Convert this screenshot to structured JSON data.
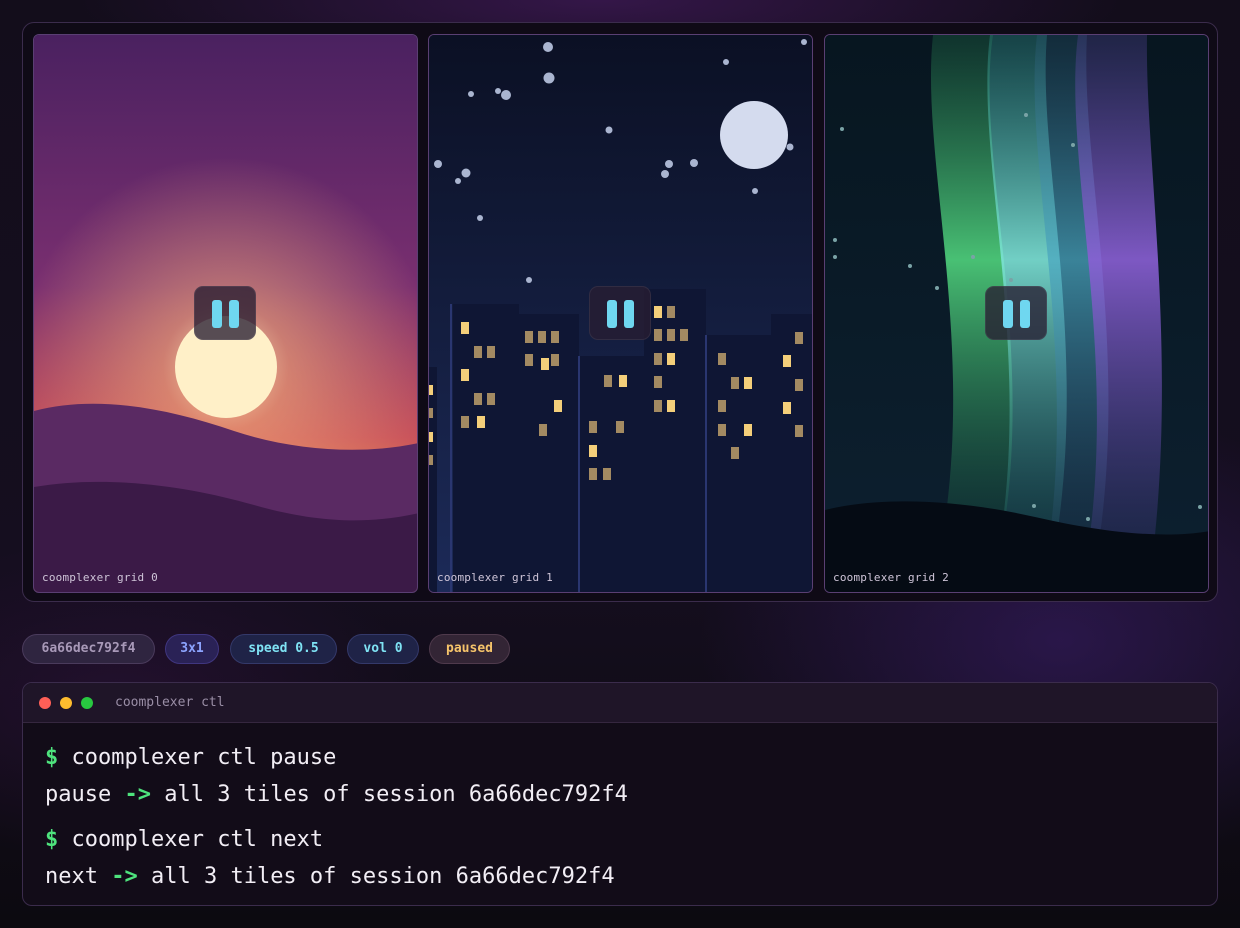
{
  "tiles": [
    {
      "caption": "coomplexer grid 0",
      "scene": "sunset",
      "control_icon": "pause-icon"
    },
    {
      "caption": "coomplexer grid 1",
      "scene": "night-city",
      "control_icon": "pause-icon"
    },
    {
      "caption": "coomplexer grid 2",
      "scene": "aurora",
      "control_icon": "pause-icon"
    }
  ],
  "status": {
    "session": "6a66dec792f4",
    "layout": "3x1",
    "speed": "speed 0.5",
    "volume": "vol 0",
    "state": "paused"
  },
  "terminal": {
    "title": "coomplexer ctl",
    "lines": [
      {
        "prompt": "$",
        "command": "coomplexer ctl pause"
      },
      {
        "result_action": "pause",
        "arrow": "->",
        "result_text": "all 3 tiles of session 6a66dec792f4"
      },
      {
        "prompt": "$",
        "command": "coomplexer ctl next"
      },
      {
        "result_action": "next",
        "arrow": "->",
        "result_text": "all 3 tiles of session 6a66dec792f4"
      }
    ]
  },
  "colors": {
    "accent_green": "#4ee37d",
    "pause_bars": "#6fd7f0",
    "paused_badge": "#f6c46a",
    "layout_badge": "#8da4ff",
    "speed_badge": "#7fe3f4"
  }
}
